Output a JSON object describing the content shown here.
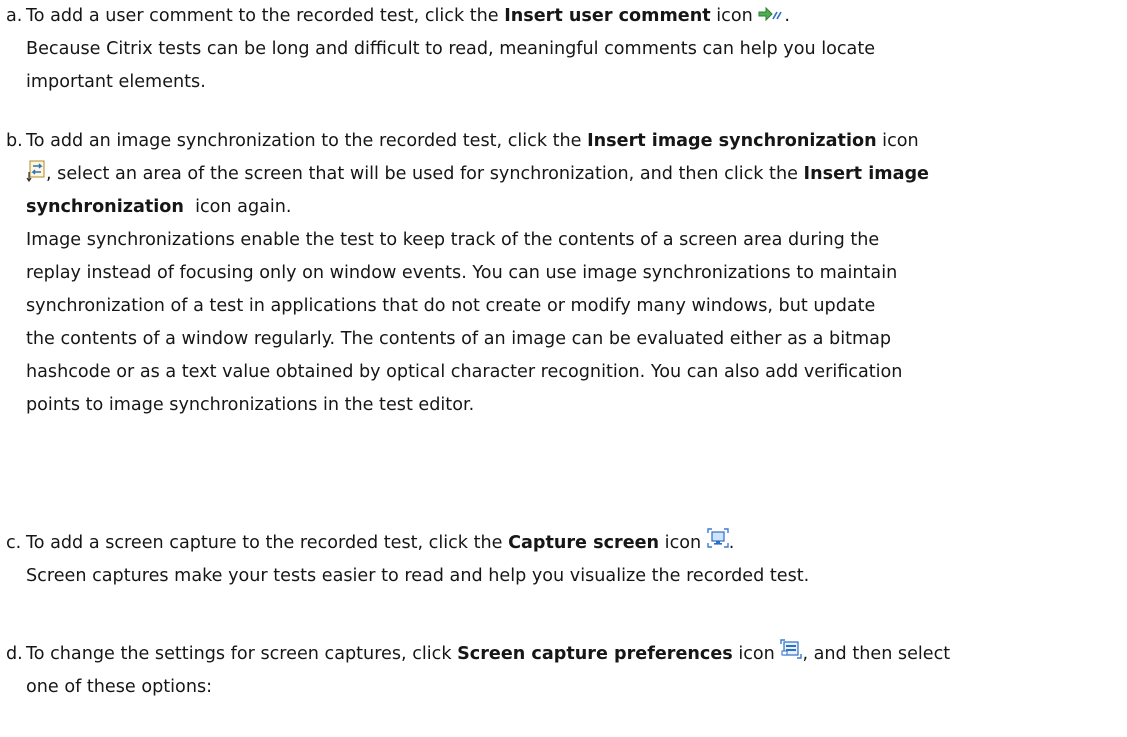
{
  "steps": [
    {
      "marker": "a.",
      "line1": {
        "pre": "To add a user comment to the recorded test, click the ",
        "bold": "Insert user comment",
        "post": " icon",
        "icon": "insert-user-comment-icon",
        "end": "."
      },
      "para": [
        "Because Citrix tests can be long and difficult to read, meaningful comments can help you locate",
        "important elements."
      ]
    },
    {
      "marker": "b.",
      "line1": {
        "pre": "To add an image synchronization to the recorded test, click the ",
        "bold": "Insert image synchronization",
        "post": " icon"
      },
      "line2": {
        "icon": "insert-image-synchronization-icon",
        "pre": ", select an area of the screen that will be used for synchronization, and then click the ",
        "bold": "Insert image"
      },
      "line3": {
        "bold": "synchronization",
        "post": "  icon again."
      },
      "para": [
        "Image synchronizations enable the test to keep track of the contents of a screen area during the",
        "replay instead of focusing only on window events. You can use image synchronizations to maintain",
        "synchronization of a test in applications that do not create or modify many windows, but update",
        "the contents of a window regularly. The contents of an image can be evaluated either as a bitmap",
        "hashcode or as a text value obtained by optical character recognition. You can also add verification",
        "points to image synchronizations in the test editor."
      ]
    },
    {
      "marker": "c.",
      "line1": {
        "pre": "To add a screen capture to the recorded test, click the ",
        "bold": "Capture screen",
        "post": " icon",
        "icon": "capture-screen-icon",
        "end": "."
      },
      "para": [
        "Screen captures make your tests easier to read and help you visualize the recorded test."
      ]
    },
    {
      "marker": "d.",
      "line1": {
        "pre": "To change the settings for screen captures, click ",
        "bold": "Screen capture preferences",
        "post": " icon",
        "icon": "screen-capture-preferences-icon",
        "end": ", and then select"
      },
      "para": [
        "one of these options:"
      ]
    }
  ],
  "colors": {
    "text": "#161616",
    "icon_green": "#4caf50",
    "icon_blue": "#2a6fc9"
  }
}
